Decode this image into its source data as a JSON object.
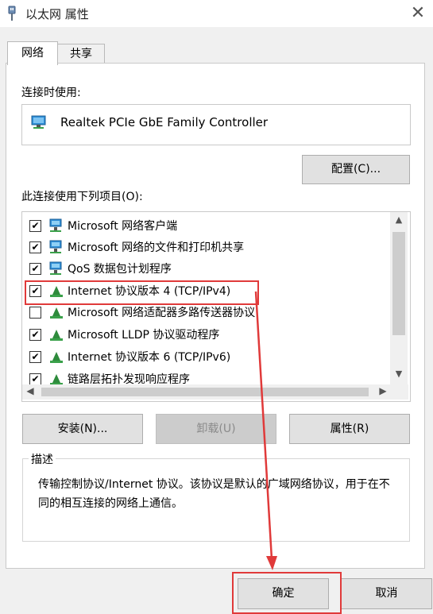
{
  "window": {
    "title": "以太网 属性",
    "close_icon": "close-icon"
  },
  "tabs": [
    {
      "label": "网络",
      "active": true
    },
    {
      "label": "共享",
      "active": false
    }
  ],
  "connect_using": {
    "label": "连接时使用:",
    "adapter": "Realtek PCIe GbE Family Controller"
  },
  "configure_button": "配置(C)...",
  "items_label": "此连接使用下列项目(O):",
  "items": [
    {
      "label": "Microsoft 网络客户端",
      "checked": true,
      "icon": "network-client-icon"
    },
    {
      "label": "Microsoft 网络的文件和打印机共享",
      "checked": true,
      "icon": "network-service-icon"
    },
    {
      "label": "QoS 数据包计划程序",
      "checked": true,
      "icon": "network-service-icon"
    },
    {
      "label": "Internet 协议版本 4 (TCP/IPv4)",
      "checked": true,
      "icon": "protocol-icon"
    },
    {
      "label": "Microsoft 网络适配器多路传送器协议",
      "checked": false,
      "icon": "protocol-icon"
    },
    {
      "label": "Microsoft LLDP 协议驱动程序",
      "checked": true,
      "icon": "protocol-icon"
    },
    {
      "label": "Internet 协议版本 6 (TCP/IPv6)",
      "checked": true,
      "icon": "protocol-icon"
    },
    {
      "label": "链路层拓扑发现响应程序",
      "checked": true,
      "icon": "protocol-icon"
    }
  ],
  "buttons": {
    "install": "安装(N)...",
    "uninstall": "卸载(U)",
    "properties": "属性(R)"
  },
  "description": {
    "legend": "描述",
    "text": "传输控制协议/Internet 协议。该协议是默认的广域网络协议，用于在不同的相互连接的网络上通信。"
  },
  "footer": {
    "ok": "确定",
    "cancel": "取消"
  },
  "colors": {
    "highlight_red": "#e03a3a",
    "panel_bg": "#ffffff",
    "window_bg": "#f0f0f0"
  }
}
